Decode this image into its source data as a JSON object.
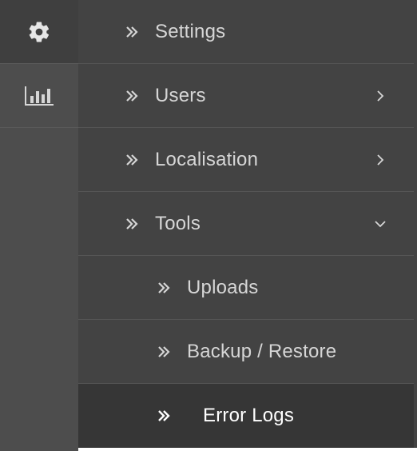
{
  "rail": {
    "items": [
      {
        "icon": "gear-icon"
      },
      {
        "icon": "bar-chart-icon"
      }
    ]
  },
  "menu": {
    "items": [
      {
        "label": "Settings",
        "icon": "double-chevron-right-icon",
        "caret": null
      },
      {
        "label": "Users",
        "icon": "double-chevron-right-icon",
        "caret": "chevron-right-icon"
      },
      {
        "label": "Localisation",
        "icon": "double-chevron-right-icon",
        "caret": "chevron-right-icon"
      },
      {
        "label": "Tools",
        "icon": "double-chevron-right-icon",
        "caret": "chevron-down-icon"
      },
      {
        "label": "Uploads",
        "icon": "double-chevron-right-icon",
        "caret": null
      },
      {
        "label": "Backup / Restore",
        "icon": "double-chevron-right-icon",
        "caret": null
      },
      {
        "label": "Error Logs",
        "icon": "double-chevron-right-icon",
        "caret": null,
        "active": true
      }
    ]
  },
  "colors": {
    "rail_bg": "#4d4d4d",
    "rail_active_bg": "#3f3f3f",
    "menu_bg": "#434343",
    "active_bg": "#363636",
    "text": "#d6d6d6",
    "active_text": "#ffffff"
  }
}
